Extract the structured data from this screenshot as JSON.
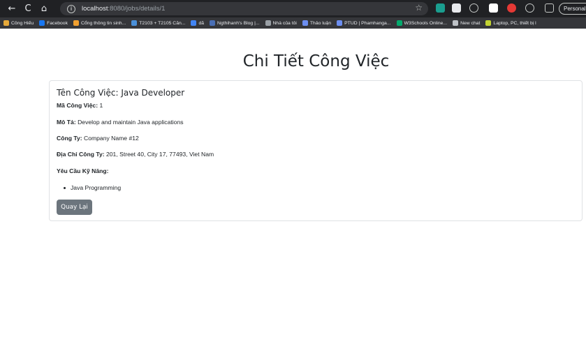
{
  "browser": {
    "nav": {
      "back": "←",
      "reload": "C",
      "home": "⌂"
    },
    "url": {
      "host": "localhost",
      "rest": ":8080/jobs/details/1"
    },
    "star": "☆",
    "profile_label": "Personal"
  },
  "bookmarks": [
    {
      "label": "Công Hiếu",
      "color": "#e6a93a"
    },
    {
      "label": "Facebook",
      "color": "#1877f2"
    },
    {
      "label": "Cổng thông tin sinh...",
      "color": "#f0a030"
    },
    {
      "label": "T2103 + T2105 Căn...",
      "color": "#4a90d9"
    },
    {
      "label": "dã",
      "color": "#4285f4"
    },
    {
      "label": "Ngthihanh's Blog |...",
      "color": "#4a6fb5"
    },
    {
      "label": "Nhà của tôi",
      "color": "#9aa0a6"
    },
    {
      "label": "Thảo luận",
      "color": "#6c8ef0"
    },
    {
      "label": "PTUD | Phamhanga...",
      "color": "#6c8ef0"
    },
    {
      "label": "W3Schools Online...",
      "color": "#04aa6d"
    },
    {
      "label": "New chat",
      "color": "#bdc1c6"
    },
    {
      "label": "Laptop, PC, thiết bị l",
      "color": "#c2d332"
    }
  ],
  "page": {
    "title": "Chi Tiết Công Việc",
    "job_title": "Tên Công Việc: Java Developer",
    "fields": {
      "id_label": "Mã Công Việc:",
      "id_value": "1",
      "desc_label": "Mô Tả:",
      "desc_value": "Develop and maintain Java applications",
      "company_label": "Công Ty:",
      "company_value": "Company Name #12",
      "address_label": "Địa Chỉ Công Ty:",
      "address_value": "201, Street 40, City 17, 77493, Viet Nam",
      "skills_label": "Yêu Cầu Kỹ Năng:"
    },
    "skills": [
      "Java Programming"
    ],
    "back_button": "Quay Lại"
  }
}
